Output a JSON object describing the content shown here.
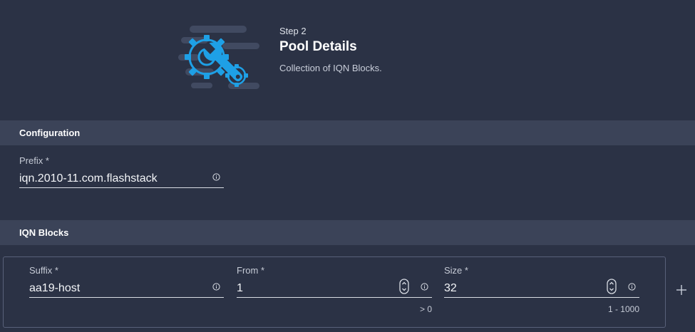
{
  "header": {
    "step": "Step 2",
    "title": "Pool Details",
    "subtitle": "Collection of IQN Blocks."
  },
  "configuration": {
    "section_title": "Configuration",
    "prefix": {
      "label": "Prefix *",
      "value": "iqn.2010-11.com.flashstack"
    }
  },
  "iqn_blocks": {
    "section_title": "IQN Blocks",
    "suffix": {
      "label": "Suffix *",
      "value": "aa19-host"
    },
    "from": {
      "label": "From *",
      "value": "1",
      "hint": "> 0"
    },
    "size": {
      "label": "Size *",
      "value": "32",
      "hint": "1 - 1000"
    }
  },
  "colors": {
    "background": "#2b3245",
    "section_header": "#3b4358",
    "accent": "#1ea0e6"
  },
  "icons": [
    "gears-wrench-icon",
    "info-icon",
    "stepper-icon",
    "plus-icon"
  ]
}
